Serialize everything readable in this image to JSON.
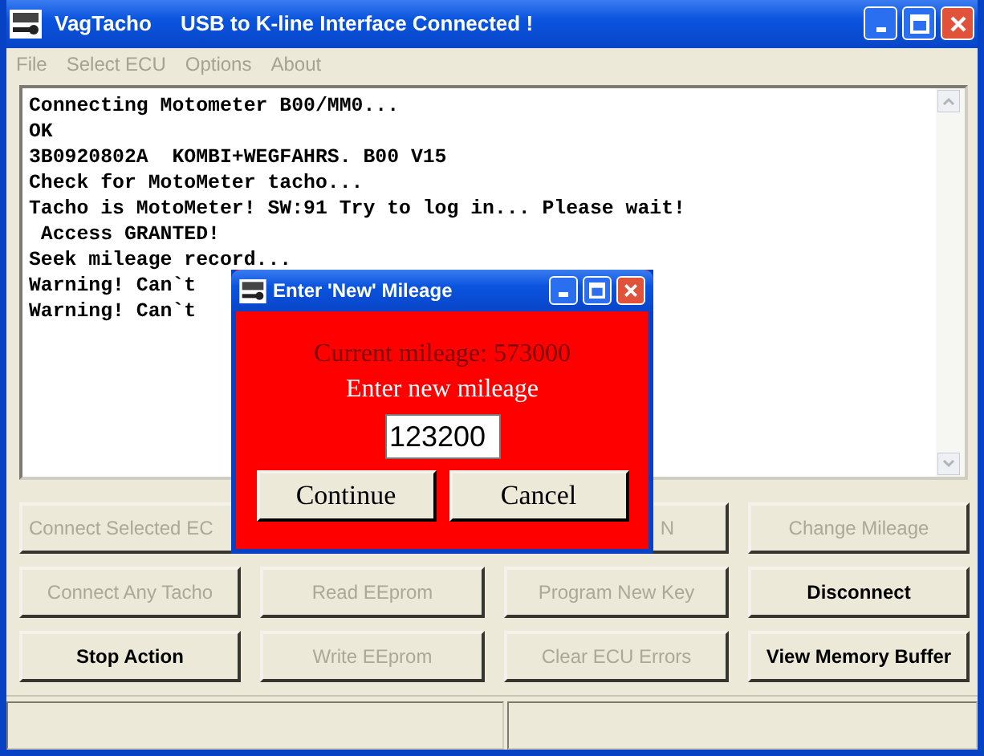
{
  "window": {
    "title": "VagTacho",
    "status": "USB to K-line Interface Connected !"
  },
  "menu": [
    "File",
    "Select ECU",
    "Options",
    "About"
  ],
  "log": [
    "Connecting Motometer B00/MM0...",
    "OK",
    "3B0920802A  KOMBI+WEGFAHRS. B00 V15",
    "Check for MotoMeter tacho...",
    "Tacho is MotoMeter! SW:91 Try to log in... Please wait!",
    " Access GRANTED!",
    "Seek mileage record...",
    "Warning! Can`t",
    "Warning! Can`t"
  ],
  "buttons": [
    {
      "label": "Connect Selected EC",
      "disabled": true
    },
    {
      "label": "N",
      "disabled": true
    },
    {
      "label": "Change Mileage",
      "disabled": true
    },
    {
      "label": "Connect Any Tacho",
      "disabled": true
    },
    {
      "label": "Read EEprom",
      "disabled": true
    },
    {
      "label": "Program New Key",
      "disabled": true
    },
    {
      "label": "Disconnect",
      "disabled": false
    },
    {
      "label": "Stop Action",
      "disabled": false
    },
    {
      "label": "Write EEprom",
      "disabled": true
    },
    {
      "label": "Clear ECU Errors",
      "disabled": true
    },
    {
      "label": "View Memory Buffer",
      "disabled": false
    }
  ],
  "dialog": {
    "title": "Enter 'New' Mileage",
    "current": "Current mileage: 573000",
    "prompt": "Enter new mileage",
    "value": "123200",
    "buttons": [
      "Continue",
      "Cancel"
    ]
  }
}
